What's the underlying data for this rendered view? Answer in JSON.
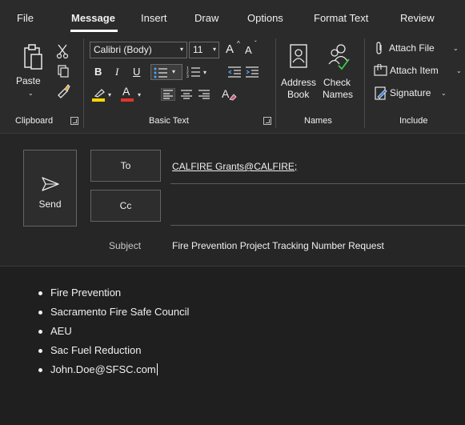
{
  "tabs": [
    "File",
    "Message",
    "Insert",
    "Draw",
    "Options",
    "Format Text",
    "Review"
  ],
  "active_tab": "Message",
  "ribbon": {
    "clipboard": {
      "paste_label": "Paste",
      "group_label": "Clipboard"
    },
    "basic_text": {
      "font_name": "Calibri (Body)",
      "font_size": "11",
      "bold": "B",
      "italic": "I",
      "underline": "U",
      "grow_font": "A",
      "shrink_font": "A",
      "highlight": "A",
      "font_color": "A",
      "group_label": "Basic Text"
    },
    "names": {
      "address_book_line1": "Address",
      "address_book_line2": "Book",
      "check_names_line1": "Check",
      "check_names_line2": "Names",
      "group_label": "Names"
    },
    "include": {
      "attach_file": "Attach File",
      "attach_item": "Attach Item",
      "signature": "Signature",
      "group_label": "Include"
    }
  },
  "header": {
    "send_label": "Send",
    "to_button": "To",
    "cc_button": "Cc",
    "to_value": "CALFIRE Grants@CALFIRE;",
    "cc_value": "",
    "subject_label": "Subject",
    "subject_value": "Fire Prevention Project Tracking Number Request"
  },
  "body": {
    "bullets": [
      "Fire Prevention",
      "Sacramento Fire Safe Council",
      "AEU",
      "Sac Fuel Reduction",
      "John.Doe@SFSC.com"
    ]
  },
  "colors": {
    "background": "#1f1f1f",
    "ribbon": "#2b2b2b",
    "text": "#f0f0f0",
    "highlight_yellow": "#ffd700",
    "font_color_red": "#e0342c"
  }
}
